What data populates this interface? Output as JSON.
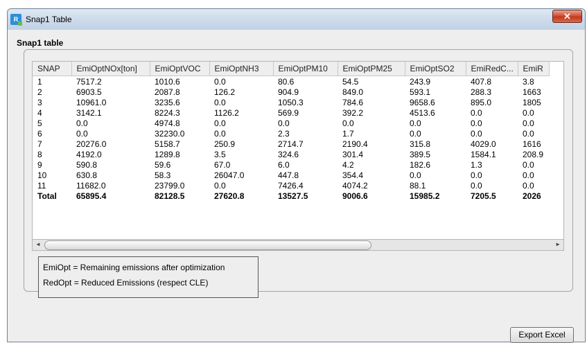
{
  "window": {
    "title": "Snap1 Table",
    "icon": "r-plus-app-icon",
    "close_glyph": "✕"
  },
  "group": {
    "title": "Snap1 table"
  },
  "table": {
    "columns": [
      "SNAP",
      "EmiOptNOx[ton]",
      "EmiOptVOC",
      "EmiOptNH3",
      "EmiOptPM10",
      "EmiOptPM25",
      "EmiOptSO2",
      "EmiRedC...",
      "EmiR"
    ],
    "rows": [
      [
        "1",
        "7517.2",
        "1010.6",
        "0.0",
        "80.6",
        "54.5",
        "243.9",
        "407.8",
        "3.8"
      ],
      [
        "2",
        "6903.5",
        "2087.8",
        "126.2",
        "904.9",
        "849.0",
        "593.1",
        "288.3",
        "1663"
      ],
      [
        "3",
        "10961.0",
        "3235.6",
        "0.0",
        "1050.3",
        "784.6",
        "9658.6",
        "895.0",
        "1805"
      ],
      [
        "4",
        "3142.1",
        "8224.3",
        "1126.2",
        "569.9",
        "392.2",
        "4513.6",
        "0.0",
        "0.0"
      ],
      [
        "5",
        "0.0",
        "4974.8",
        "0.0",
        "0.0",
        "0.0",
        "0.0",
        "0.0",
        "0.0"
      ],
      [
        "6",
        "0.0",
        "32230.0",
        "0.0",
        "2.3",
        "1.7",
        "0.0",
        "0.0",
        "0.0"
      ],
      [
        "7",
        "20276.0",
        "5158.7",
        "250.9",
        "2714.7",
        "2190.4",
        "315.8",
        "4029.0",
        "1616"
      ],
      [
        "8",
        "4192.0",
        "1289.8",
        "3.5",
        "324.6",
        "301.4",
        "389.5",
        "1584.1",
        "208.9"
      ],
      [
        "9",
        "590.8",
        "59.6",
        "67.0",
        "6.0",
        "4.2",
        "182.6",
        "1.3",
        "0.0"
      ],
      [
        "10",
        "630.8",
        "58.3",
        "26047.0",
        "447.8",
        "354.4",
        "0.0",
        "0.0",
        "0.0"
      ],
      [
        "11",
        "11682.0",
        "23799.0",
        "0.0",
        "7426.4",
        "4074.2",
        "88.1",
        "0.0",
        "0.0"
      ]
    ],
    "total": [
      "Total",
      "65895.4",
      "82128.5",
      "27620.8",
      "13527.5",
      "9006.6",
      "15985.2",
      "7205.5",
      "2026"
    ]
  },
  "legend": {
    "line1": "EmiOpt = Remaining emissions after optimization",
    "line2": "RedOpt = Reduced Emissions (respect CLE)"
  },
  "buttons": {
    "export_label": "Export Excel"
  },
  "scrollbar": {
    "left_arrow": "◄",
    "right_arrow": "►"
  }
}
